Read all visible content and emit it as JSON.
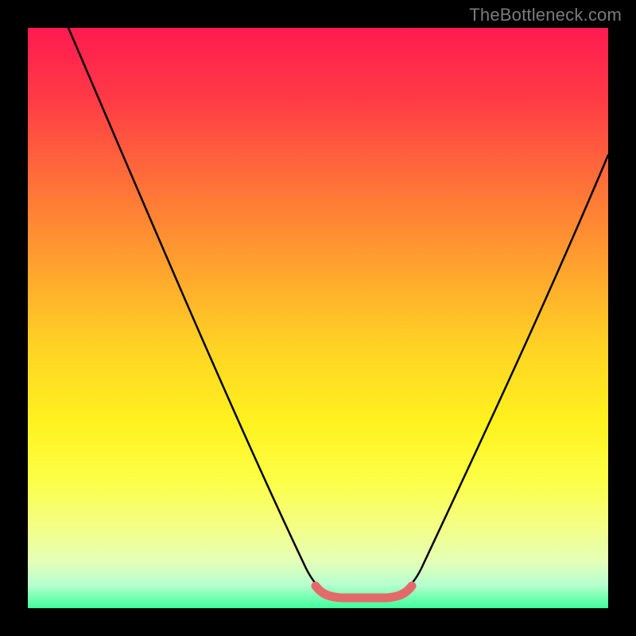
{
  "watermark": "TheBottleneck.com",
  "chart_data": {
    "type": "line",
    "title": "",
    "xlabel": "",
    "ylabel": "",
    "xlim": [
      0,
      100
    ],
    "ylim": [
      0,
      100
    ],
    "grid": false,
    "legend": false,
    "series": [
      {
        "name": "bottleneck-curve",
        "x": [
          7,
          12,
          17,
          22,
          27,
          32,
          37,
          42,
          47,
          51,
          53,
          55,
          57,
          59,
          61,
          63,
          66,
          71,
          76,
          81,
          86,
          91,
          96,
          100
        ],
        "y": [
          100,
          89,
          78,
          67,
          56,
          45,
          34,
          23,
          12,
          4,
          2.5,
          2,
          2,
          2,
          2.5,
          4,
          10,
          20,
          30,
          40,
          50,
          60,
          70,
          78
        ]
      },
      {
        "name": "optimal-range-highlight",
        "x": [
          51,
          53,
          55,
          57,
          59,
          61,
          63
        ],
        "y": [
          4,
          2.5,
          2,
          2,
          2,
          2.5,
          4
        ]
      }
    ]
  },
  "colors": {
    "curve": "#000000",
    "highlight": "#e46a6a"
  }
}
